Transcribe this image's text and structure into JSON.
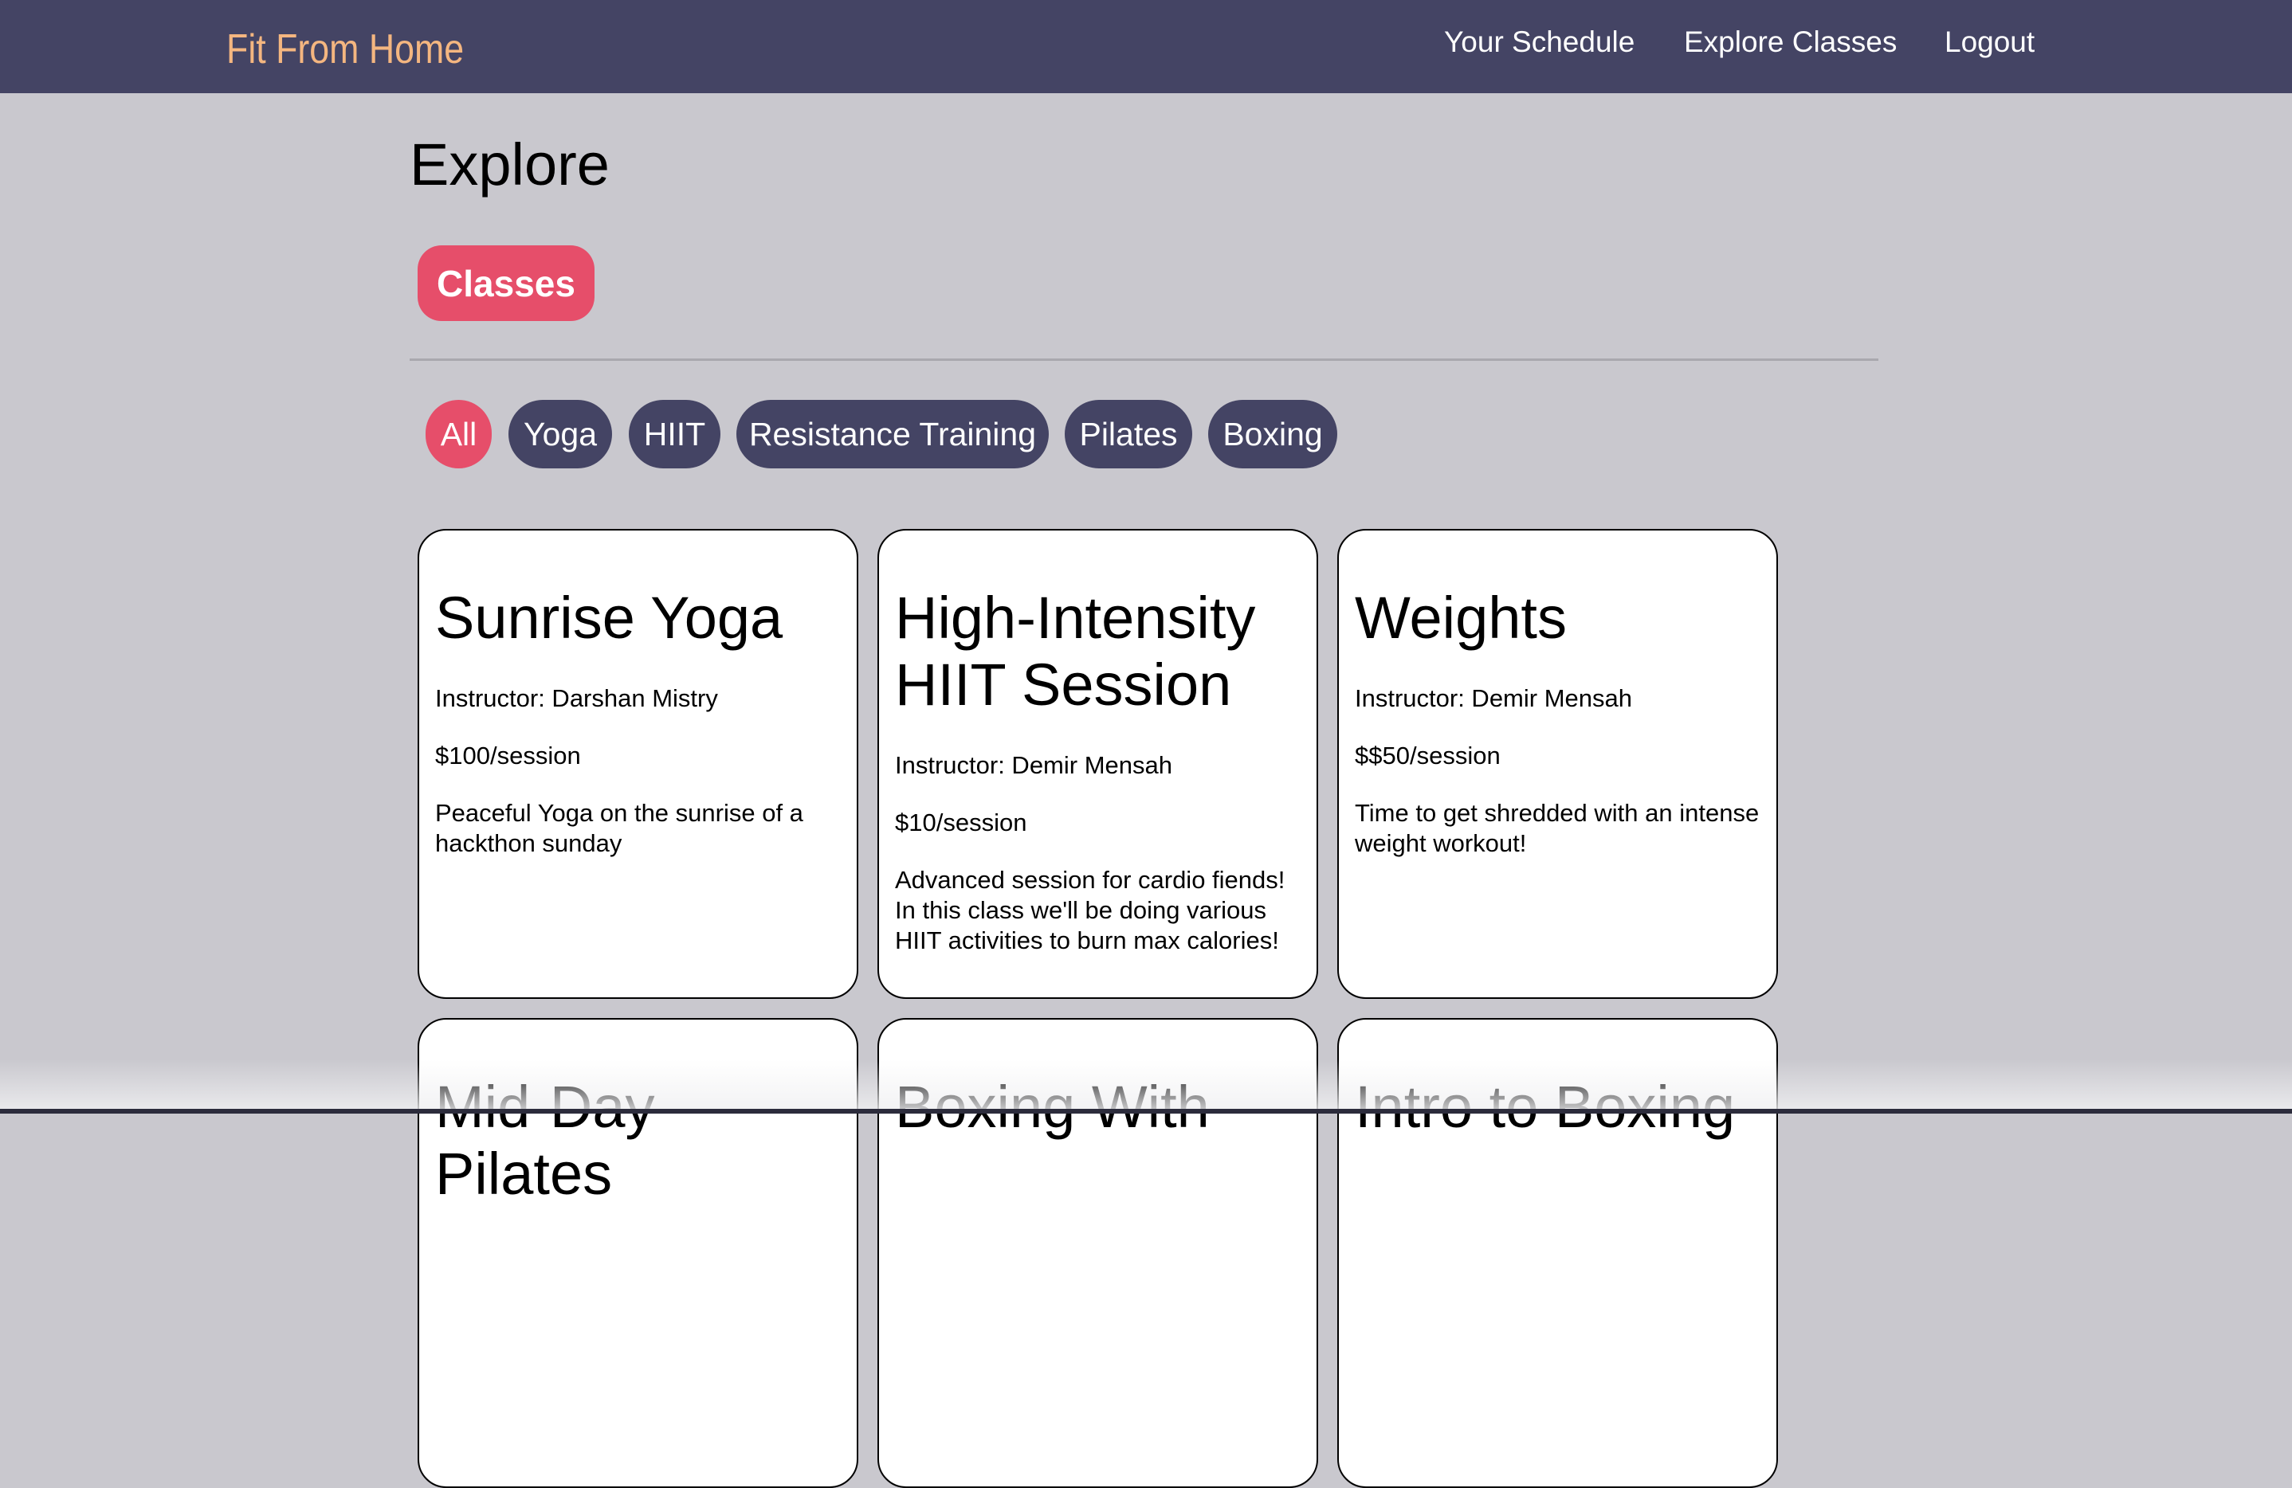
{
  "app": {
    "brand": "Fit From Home"
  },
  "nav": {
    "schedule": "Your Schedule",
    "explore": "Explore Classes",
    "logout": "Logout"
  },
  "page": {
    "title": "Explore",
    "section_tab": "Classes"
  },
  "filters": [
    "All",
    "Yoga",
    "HIIT",
    "Resistance Training",
    "Pilates",
    "Boxing"
  ],
  "active_filter": "All",
  "colors": {
    "navbar": "#444464",
    "brand": "#f4b680",
    "accent": "#e64e6a",
    "background": "#c9c8ce"
  },
  "classes": [
    {
      "title": "Sunrise Yoga",
      "instructor": "Instructor: Darshan Mistry",
      "price": "$100/session",
      "description": "Peaceful Yoga on the sunrise of a hackthon sunday"
    },
    {
      "title": "High-Intensity HIIT Session",
      "instructor": "Instructor: Demir Mensah",
      "price": "$10/session",
      "description": "Advanced session for cardio fiends! In this class we'll be doing various HIIT activities to burn max calories!"
    },
    {
      "title": "Weights",
      "instructor": "Instructor: Demir Mensah",
      "price": "$$50/session",
      "description": "Time to get shredded with an intense weight workout!"
    },
    {
      "title": "Mid-Day Pilates"
    },
    {
      "title": "Boxing With"
    },
    {
      "title": "Intro to Boxing"
    }
  ]
}
